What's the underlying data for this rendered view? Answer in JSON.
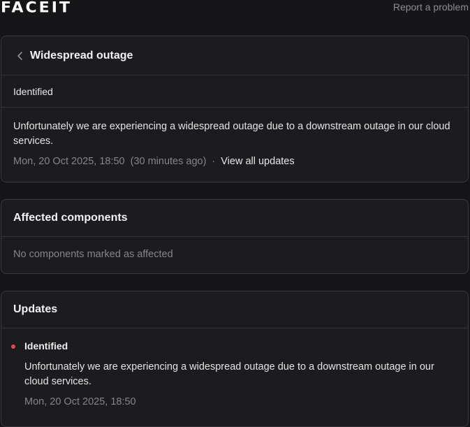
{
  "header": {
    "logo_text": "FACEIT",
    "report_label": "Report a problem"
  },
  "incident": {
    "title": "Widespread outage",
    "status": "Identified",
    "description": "Unfortunately we are experiencing a widespread outage due to a downstream outage in our cloud services.",
    "timestamp": "Mon, 20 Oct 2025, 18:50",
    "relative_time": "(30 minutes ago)",
    "separator": "·",
    "view_all_label": "View all updates"
  },
  "affected": {
    "title": "Affected components",
    "empty_text": "No components marked as affected"
  },
  "updates": {
    "title": "Updates",
    "items": [
      {
        "status": "Identified",
        "status_color": "#e5484d",
        "text": "Unfortunately we are experiencing a widespread outage due to a downstream outage in our cloud services.",
        "time": "Mon, 20 Oct 2025, 18:50"
      }
    ]
  }
}
